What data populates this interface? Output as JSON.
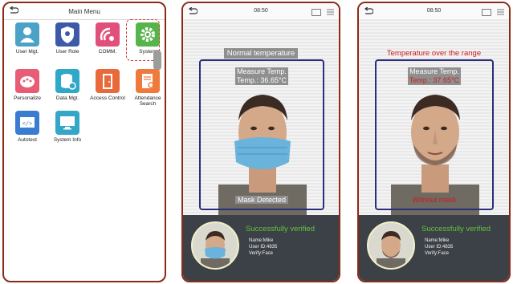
{
  "menu": {
    "title": "Main Menu",
    "tiles": [
      {
        "label": "User Mgt.",
        "icon": "user-icon",
        "color": "#4aa3c6"
      },
      {
        "label": "User Role",
        "icon": "shield-icon",
        "color": "#3c5aa8"
      },
      {
        "label": "COMM.",
        "icon": "antenna-icon",
        "color": "#e0507a"
      },
      {
        "label": "System",
        "icon": "gear-icon",
        "color": "#55b44a"
      },
      {
        "label": "Personalize",
        "icon": "palette-icon",
        "color": "#e85d75"
      },
      {
        "label": "Data Mgt.",
        "icon": "database-icon",
        "color": "#2fa8c9"
      },
      {
        "label": "Access Control",
        "icon": "door-icon",
        "color": "#e86a3a"
      },
      {
        "label": "Attendance\nSearch",
        "icon": "document-search-icon",
        "color": "#ef7a3c"
      },
      {
        "label": "Autotest",
        "icon": "code-screen-icon",
        "color": "#3b7bd0"
      },
      {
        "label": "System Info",
        "icon": "monitor-icon",
        "color": "#34a6c6"
      }
    ]
  },
  "screens": [
    {
      "time": "08:50",
      "status": "Normal temperature",
      "temp_label": "Measure Temp.",
      "temp_value": "Temp.: 36.65°C",
      "mask": "Mask Detected",
      "verified": "Successfully verified",
      "name": "Name:Mike",
      "user_id": "User ID:4835",
      "verify": "Verify:Face"
    },
    {
      "time": "08:50",
      "status": "Temperature over the range",
      "temp_label": "Measure Temp.",
      "temp_value": "Temp.: 37.65°C",
      "mask": "Without mask",
      "verified": "Successfully verified",
      "name": "Name:Mike",
      "user_id": "User ID:4835",
      "verify": "Verify:Face"
    }
  ],
  "colors": {
    "frame": "#8b2a16",
    "face_box": "#2b2e7a",
    "alert": "#d11b1b",
    "success": "#66c23a"
  }
}
